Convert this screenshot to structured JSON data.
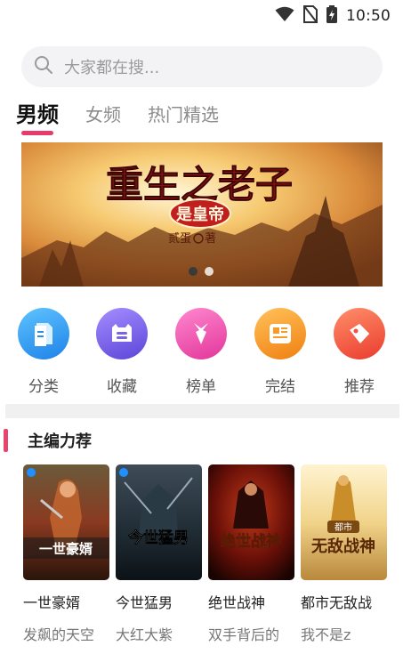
{
  "status_bar": {
    "time": "10:50",
    "icons": [
      "wifi-icon",
      "no-sim-icon",
      "battery-charging-icon"
    ]
  },
  "search": {
    "placeholder": "大家都在搜..."
  },
  "tabs": [
    {
      "label": "男频",
      "active": true
    },
    {
      "label": "女频",
      "active": false
    },
    {
      "label": "热门精选",
      "active": false
    }
  ],
  "banner": {
    "title": "重生之老子",
    "subtitle": "是皇帝",
    "author": "贰蛋",
    "author_suffix": "著",
    "page_count": 2,
    "active_page": 1
  },
  "categories": [
    {
      "label": "分类",
      "icon": "category-icon",
      "color": "#2a9df4"
    },
    {
      "label": "收藏",
      "icon": "favorite-icon",
      "color": "#7a63e8"
    },
    {
      "label": "榜单",
      "icon": "ranking-icon",
      "color": "#ee4fa4"
    },
    {
      "label": "完结",
      "icon": "completed-icon",
      "color": "#f59b26"
    },
    {
      "label": "推荐",
      "icon": "recommend-icon",
      "color": "#f2523e"
    }
  ],
  "section": {
    "title": "主编力荐"
  },
  "books": [
    {
      "title": "一世豪婿",
      "author": "发飙的天空",
      "cover_text": "一世豪婿"
    },
    {
      "title": "今世猛男",
      "author": "大红大紫",
      "cover_text": "今世猛男"
    },
    {
      "title": "绝世战神",
      "author": "双手背后的",
      "cover_text": "绝世战神"
    },
    {
      "title": "都市无敌战",
      "author": "我不是z",
      "cover_text": "无敌战神",
      "cover_tag": "都市"
    }
  ],
  "colors": {
    "accent": "#e93b6b",
    "section_bar": "#e9436f"
  }
}
